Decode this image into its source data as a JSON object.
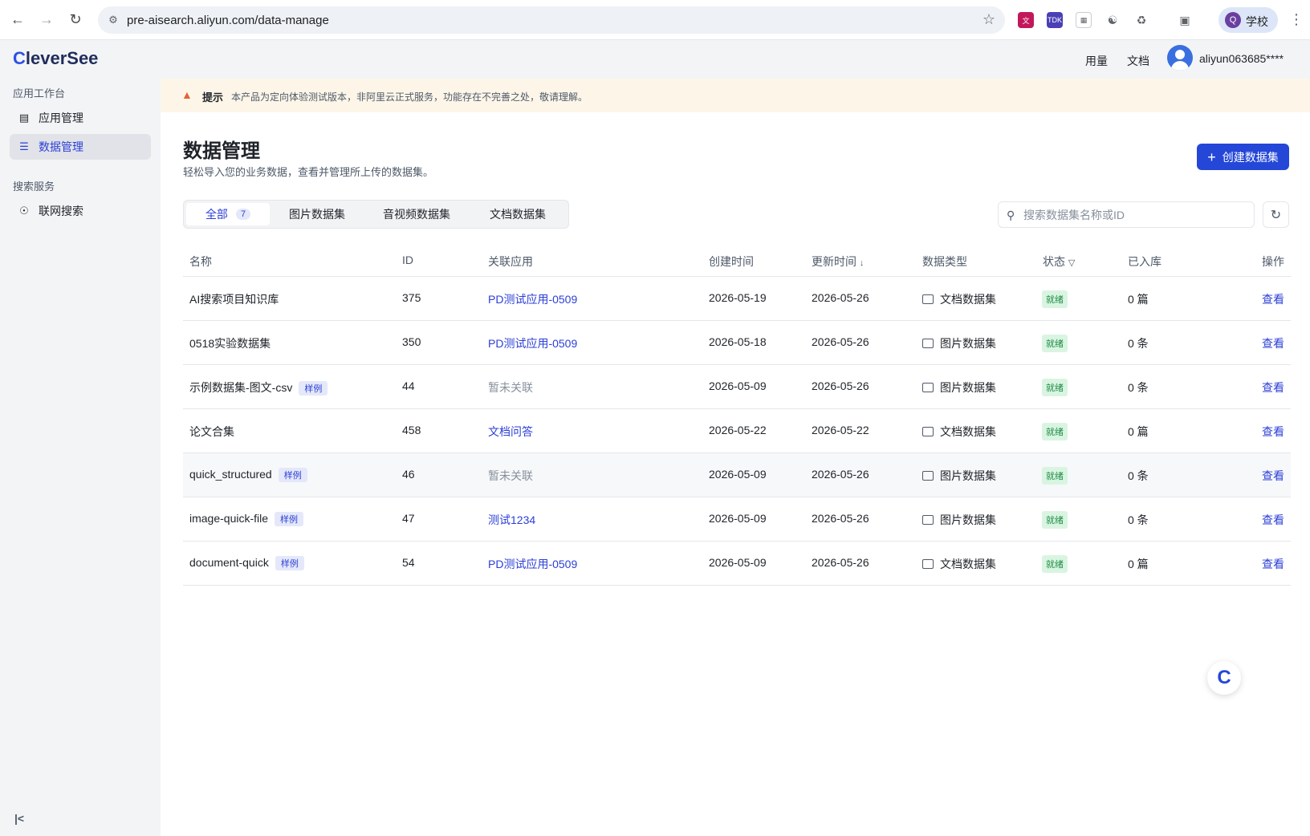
{
  "browser": {
    "url": "pre-aisearch.aliyun.com/data-manage",
    "profile_name": "学校",
    "profile_initial": "Q"
  },
  "sidebar": {
    "logo": "CleverSee",
    "section1": "应用工作台",
    "items1": [
      {
        "label": "应用管理",
        "icon": "app-icon"
      },
      {
        "label": "数据管理",
        "icon": "database-icon",
        "active": true
      }
    ],
    "section2": "搜索服务",
    "items2": [
      {
        "label": "联网搜索",
        "icon": "globe-icon"
      }
    ]
  },
  "header": {
    "usage": "用量",
    "docs": "文档",
    "username": "aliyun063685****"
  },
  "notice": {
    "title": "提示",
    "text": "本产品为定向体验测试版本，非阿里云正式服务，功能存在不完善之处，敬请理解。"
  },
  "page": {
    "title": "数据管理",
    "subtitle": "轻松导入您的业务数据，查看并管理所上传的数据集。",
    "create_label": "创建数据集"
  },
  "tabs": [
    {
      "label": "全部",
      "count": "7",
      "active": true
    },
    {
      "label": "图片数据集"
    },
    {
      "label": "音视频数据集"
    },
    {
      "label": "文档数据集"
    }
  ],
  "search": {
    "placeholder": "搜索数据集名称或ID"
  },
  "table": {
    "headers": {
      "name": "名称",
      "id": "ID",
      "app": "关联应用",
      "created": "创建时间",
      "updated": "更新时间",
      "type": "数据类型",
      "status": "状态",
      "stored": "已入库",
      "action": "操作"
    },
    "rows": [
      {
        "name": "AI搜索项目知识库",
        "tag": "",
        "id": "375",
        "app": "PD测试应用-0509",
        "app_linked": true,
        "created": "2026-05-19",
        "updated": "2026-05-26",
        "type": "文档数据集",
        "status": "就绪",
        "stored": "0 篇",
        "action": "查看"
      },
      {
        "name": "0518实验数据集",
        "tag": "",
        "id": "350",
        "app": "PD测试应用-0509",
        "app_linked": true,
        "created": "2026-05-18",
        "updated": "2026-05-26",
        "type": "图片数据集",
        "status": "就绪",
        "stored": "0 条",
        "action": "查看"
      },
      {
        "name": "示例数据集-图文-csv",
        "tag": "样例",
        "id": "44",
        "app": "暂未关联",
        "app_linked": false,
        "created": "2026-05-09",
        "updated": "2026-05-26",
        "type": "图片数据集",
        "status": "就绪",
        "stored": "0 条",
        "action": "查看"
      },
      {
        "name": "论文合集",
        "tag": "",
        "id": "458",
        "app": "文档问答",
        "app_linked": true,
        "created": "2026-05-22",
        "updated": "2026-05-22",
        "type": "文档数据集",
        "status": "就绪",
        "stored": "0 篇",
        "action": "查看"
      },
      {
        "name": "quick_structured",
        "tag": "样例",
        "id": "46",
        "app": "暂未关联",
        "app_linked": false,
        "created": "2026-05-09",
        "updated": "2026-05-26",
        "type": "图片数据集",
        "status": "就绪",
        "stored": "0 条",
        "action": "查看"
      },
      {
        "name": "image-quick-file",
        "tag": "样例",
        "id": "47",
        "app": "测试1234",
        "app_linked": true,
        "created": "2026-05-09",
        "updated": "2026-05-26",
        "type": "图片数据集",
        "status": "就绪",
        "stored": "0 条",
        "action": "查看"
      },
      {
        "name": "document-quick",
        "tag": "样例",
        "id": "54",
        "app": "PD测试应用-0509",
        "app_linked": true,
        "created": "2026-05-09",
        "updated": "2026-05-26",
        "type": "文档数据集",
        "status": "就绪",
        "stored": "0 篇",
        "action": "查看"
      }
    ]
  },
  "colors": {
    "accent": "#2447d8",
    "link": "#2b3fd6",
    "status_bg": "#d9f5e1",
    "status_text": "#1e8a45",
    "notice_bg": "#fdf6e8"
  }
}
